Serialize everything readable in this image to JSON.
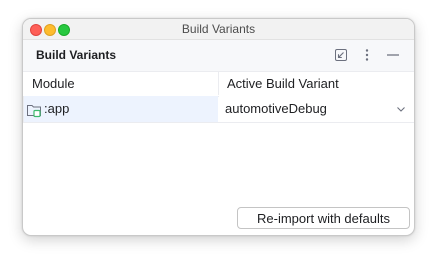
{
  "window": {
    "title": "Build Variants"
  },
  "panel": {
    "title": "Build Variants",
    "icons": [
      "collapse-icon",
      "more-vertical-icon",
      "hide-icon"
    ]
  },
  "table": {
    "columns": [
      "Module",
      "Active Build Variant"
    ],
    "rows": [
      {
        "module": ":app",
        "variant": "automotiveDebug",
        "icon": "android-module-folder-icon"
      }
    ]
  },
  "buttons": {
    "reimport_label": "Re-import with defaults"
  },
  "colors": {
    "selected_row_bg": "#edf3fe",
    "close": "#fe5f57",
    "minimize": "#febc2e",
    "zoom": "#28c840",
    "module_icon_accent": "#3dba6d"
  }
}
